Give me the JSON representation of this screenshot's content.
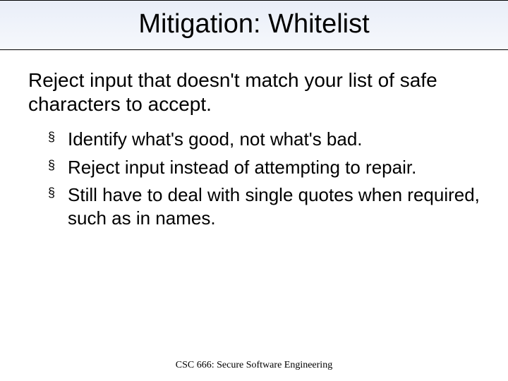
{
  "title": "Mitigation: Whitelist",
  "lead": "Reject input that doesn't match your list of safe characters to accept.",
  "bullets": [
    "Identify what's good, not what's bad.",
    "Reject input instead of attempting to repair.",
    "Still have to deal with single quotes when required, such as in names."
  ],
  "bullet_marker": "§",
  "footer": "CSC 666: Secure Software Engineering"
}
